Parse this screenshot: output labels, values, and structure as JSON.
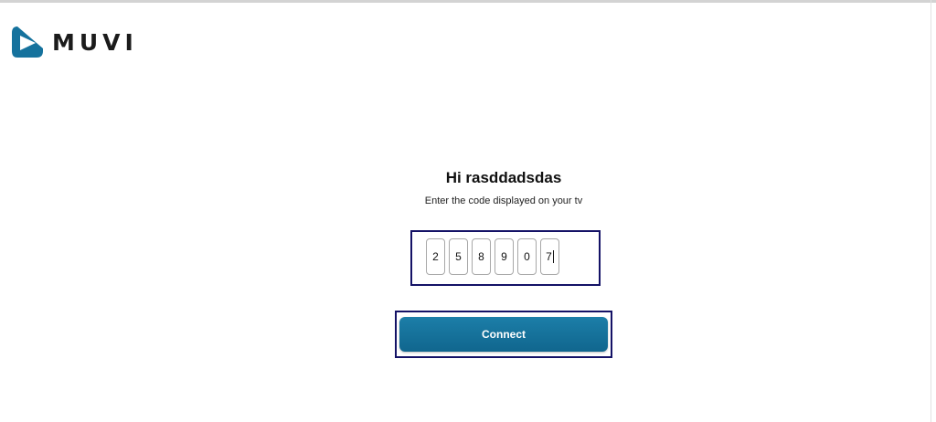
{
  "brand": {
    "name": "MUVI",
    "logo_icon": "muvi-logo-icon",
    "accent_color": "#1a6f97"
  },
  "page": {
    "greeting": "Hi rasddadsdas",
    "instruction": "Enter the code displayed on your tv"
  },
  "code": {
    "digits": [
      "2",
      "5",
      "8",
      "9",
      "0",
      "7"
    ]
  },
  "actions": {
    "connect_label": "Connect",
    "button_color": "#15729d"
  },
  "highlight": {
    "color": "#141266"
  }
}
